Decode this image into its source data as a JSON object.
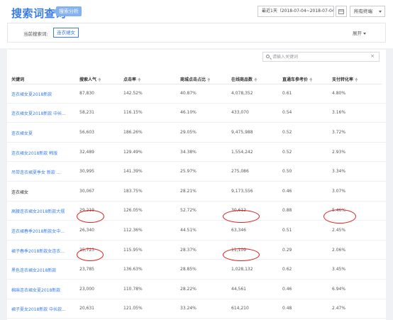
{
  "header": {
    "title": "搜索词查询",
    "badge": "搜索分析",
    "date_range": "最近1天（2018-07-04~2018-07-04）",
    "terminal": "所有终端"
  },
  "filter": {
    "label": "当前搜索词:",
    "tag": "连衣裙女",
    "expand": "展开"
  },
  "search": {
    "placeholder": "请输入关键词",
    "clear": "×"
  },
  "table": {
    "sort_glyph": "≑",
    "columns": [
      "关键词",
      "搜索人气",
      "点击率",
      "商城点击占比",
      "在线商品数",
      "直通车参考价",
      "支付转化率"
    ],
    "rows": [
      [
        "连衣裙女夏2018新款",
        "87,830",
        "142.52%",
        "40.87%",
        "4,078,352",
        "0.61",
        "4.80%"
      ],
      [
        "连衣裙女夏2018新款 中长...",
        "58,231",
        "116.15%",
        "46.10%",
        "433,070",
        "0.54",
        "3.16%"
      ],
      [
        "连衣裙女夏",
        "56,603",
        "186.26%",
        "29.05%",
        "9,475,988",
        "0.52",
        "3.72%"
      ],
      [
        "连衣裙女2018新款 韩版",
        "32,489",
        "129.49%",
        "34.38%",
        "1,554,242",
        "0.52",
        "2.93%"
      ],
      [
        "吊带连衣裙夏季女 新款 ...",
        "30,995",
        "141.39%",
        "25.97%",
        "275,086",
        "0.50",
        "3.34%"
      ],
      [
        "连衣裙女",
        "30,067",
        "183.75%",
        "28.21%",
        "9,173,556",
        "0.46",
        "3.07%"
      ],
      [
        "高腰连衣裙女2018新款大摆",
        "29,219",
        "126.05%",
        "52.72%",
        "30,612",
        "0.88",
        "5.46%"
      ],
      [
        "连衣裙春季2018新款女中...",
        "26,340",
        "112.36%",
        "44.51%",
        "63,346",
        "0.51",
        "2.45%"
      ],
      [
        "裙子春季2018新款女连衣...",
        "25,723",
        "115.95%",
        "28.37%",
        "11,109",
        "0.29",
        "2.06%"
      ],
      [
        "黑色连衣裙女2018新款",
        "23,785",
        "136.63%",
        "28.85%",
        "1,028,132",
        "0.62",
        "3.45%"
      ],
      [
        "棉麻连衣裙女夏2018新款",
        "23,000",
        "110.78%",
        "28.22%",
        "44,561",
        "0.46",
        "6.94%"
      ],
      [
        "裙子夏女2018新款 中长款...",
        "20,631",
        "121.05%",
        "33.24%",
        "614,210",
        "0.48",
        "2.47%"
      ]
    ]
  }
}
